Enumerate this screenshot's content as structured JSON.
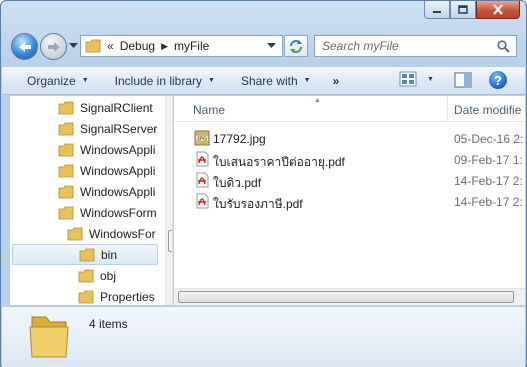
{
  "window": {
    "caption_buttons": [
      "minimize",
      "maximize",
      "close"
    ]
  },
  "address": {
    "overflow": "«",
    "breadcrumbs": [
      "Debug",
      "myFile"
    ]
  },
  "search": {
    "placeholder": "Search myFile"
  },
  "toolbar": {
    "organize": "Organize",
    "include_in_library": "Include in library",
    "share_with": "Share with",
    "more": "»",
    "help": "?"
  },
  "navpane": {
    "items": [
      {
        "label": "SignalRClient"
      },
      {
        "label": "SignalRServer"
      },
      {
        "label": "WindowsAppli"
      },
      {
        "label": "WindowsAppli"
      },
      {
        "label": "WindowsAppli"
      },
      {
        "label": "WindowsForm"
      },
      {
        "label": "WindowsFor"
      },
      {
        "label": "bin",
        "selected": true
      },
      {
        "label": "obj"
      },
      {
        "label": "Properties"
      }
    ]
  },
  "files": {
    "columns": {
      "name": "Name",
      "date": "Date modifie"
    },
    "rows": [
      {
        "name": "17792.jpg",
        "date": "05-Dec-16 2:",
        "type": "jpg"
      },
      {
        "name": "ใบเสนอราคาปีต่ออายุ.pdf",
        "date": "09-Feb-17 1:",
        "type": "pdf"
      },
      {
        "name": "ใบดิว.pdf",
        "date": "14-Feb-17 2:",
        "type": "pdf"
      },
      {
        "name": "ใบรับรองภาษี.pdf",
        "date": "14-Feb-17 2:",
        "type": "pdf"
      }
    ]
  },
  "details": {
    "item_count": "4 items"
  },
  "colors": {
    "accent": "#1e395b",
    "folder": "#e8c158"
  }
}
